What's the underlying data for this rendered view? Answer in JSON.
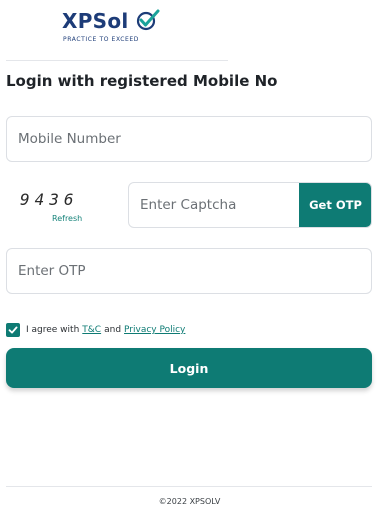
{
  "brand": {
    "name": "XPSolv",
    "name_display": "XPSol",
    "tagline": "PRACTICE TO EXCEED"
  },
  "heading": "Login with registered Mobile No",
  "form": {
    "mobile_placeholder": "Mobile Number",
    "captcha_code": "9436",
    "captcha_refresh": "Refresh",
    "captcha_placeholder": "Enter Captcha",
    "get_otp_label": "Get OTP",
    "otp_placeholder": "Enter OTP",
    "agree_checked": true,
    "agree_prefix": "I agree with",
    "tnc_link": "T&C",
    "and_text": "and",
    "privacy_link": "Privacy Policy",
    "login_label": "Login"
  },
  "footer": "©2022 XPSOLV",
  "colors": {
    "accent": "#0e7b74",
    "brand_blue": "#1d3c78",
    "brand_teal": "#1aa39a"
  },
  "icons": {
    "brand_check": "check-mark-icon",
    "agree_check": "checkbox-checked-icon"
  }
}
